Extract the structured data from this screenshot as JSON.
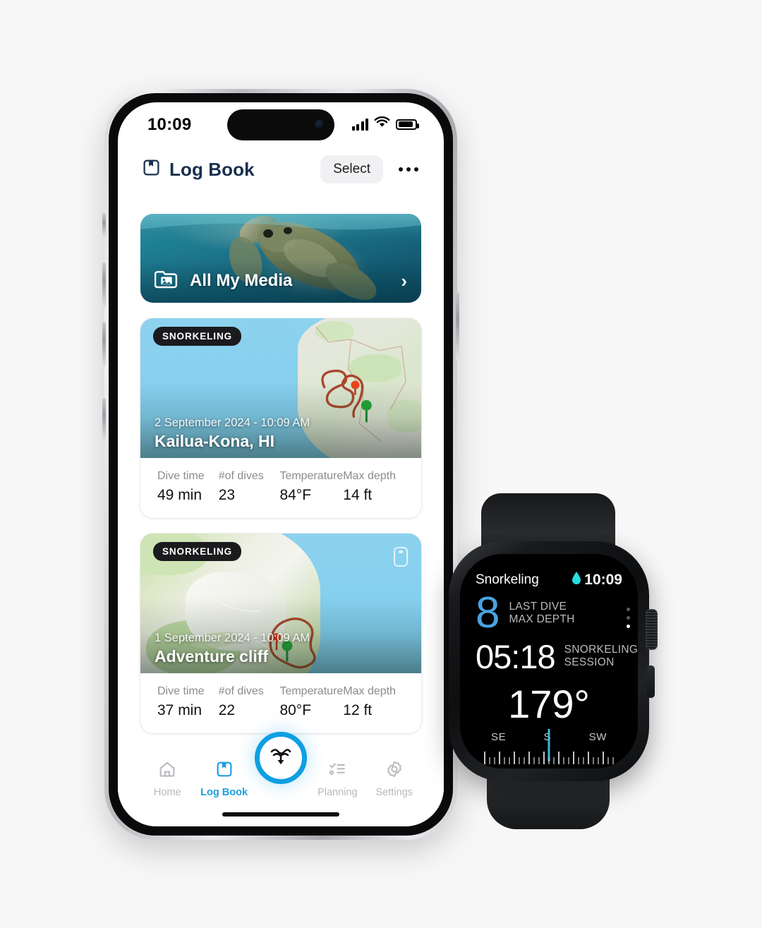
{
  "phone": {
    "status_bar": {
      "time": "10:09",
      "signal_icon": "cellular-signal-icon",
      "wifi_icon": "wifi-icon",
      "battery_icon": "battery-icon"
    },
    "navbar": {
      "title": "Log Book",
      "title_icon": "log-book-icon",
      "select_label": "Select",
      "more_icon": "more-options-icon"
    },
    "media_banner": {
      "label": "All My Media",
      "icon": "photo-stack-icon",
      "chevron": "›"
    },
    "dive_cards": [
      {
        "badge": "SNORKELING",
        "date": "2 September 2024 - 10:09 AM",
        "place": "Kailua-Kona, HI",
        "has_media_chip": false,
        "stats": [
          {
            "label": "Dive time",
            "value": "49 min"
          },
          {
            "label": "#of dives",
            "value": "23"
          },
          {
            "label": "Temperature",
            "value": "84°F"
          },
          {
            "label": "Max depth",
            "value": "14 ft"
          }
        ]
      },
      {
        "badge": "SNORKELING",
        "date": "1 September 2024 - 10:09 AM",
        "place": "Adventure cliff",
        "has_media_chip": true,
        "media_chip_icon": "media-phone-icon",
        "stats": [
          {
            "label": "Dive time",
            "value": "37 min"
          },
          {
            "label": "#of dives",
            "value": "22"
          },
          {
            "label": "Temperature",
            "value": "80°F"
          },
          {
            "label": "Max depth",
            "value": "12 ft"
          }
        ]
      }
    ],
    "tab_bar": {
      "items": [
        {
          "label": "Home",
          "icon": "home-icon",
          "active": false
        },
        {
          "label": "Log Book",
          "icon": "log-book-icon",
          "active": true
        },
        {
          "label": "Planning",
          "icon": "planning-checklist-icon",
          "active": false
        },
        {
          "label": "Settings",
          "icon": "gear-icon",
          "active": false
        }
      ],
      "fab_icon": "dive-descend-icon"
    }
  },
  "watch": {
    "activity": "Snorkeling",
    "time": "10:09",
    "water_icon": "water-drop-icon",
    "depth_value": "8",
    "depth_caption_line1": "LAST DIVE",
    "depth_caption_line2": "MAX DEPTH",
    "timer_value": "05:18",
    "timer_caption_line1": "SNORKELING",
    "timer_caption_line2": "SESSION",
    "heading": "179°",
    "compass_labels": [
      "SE",
      "S",
      "SW"
    ]
  },
  "colors": {
    "accent_blue": "#0f9fe3",
    "title_navy": "#19304f",
    "watch_depth_blue": "#4aa3e0",
    "compass_needle": "#3fb9d9",
    "badge_dark": "#1b1b1e",
    "page_bg": "#f7f7f7"
  }
}
